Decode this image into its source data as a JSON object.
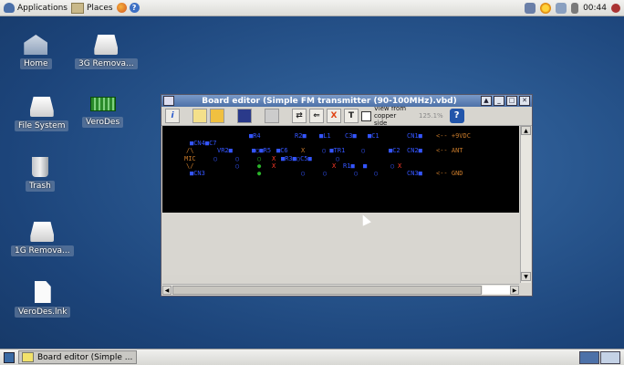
{
  "top_panel": {
    "applications_label": "Applications",
    "places_label": "Places",
    "clock": "00:44"
  },
  "desktop_icons": [
    {
      "label": "Home",
      "icon": "home-folder-icon"
    },
    {
      "label": "3G Remova...",
      "icon": "drive-icon"
    },
    {
      "label": "File System",
      "icon": "drive-icon"
    },
    {
      "label": "VeroDes",
      "icon": "verodes-app-icon"
    },
    {
      "label": "Trash",
      "icon": "trash-icon"
    },
    {
      "label": "1G Remova...",
      "icon": "drive-icon"
    },
    {
      "label": "VeroDes.lnk",
      "icon": "file-icon"
    }
  ],
  "window": {
    "title": "Board editor (Simple FM transmitter (90-100MHz).vbd)",
    "toolbar": {
      "info": "i",
      "text_tool": "T",
      "delete": "X",
      "view_from_copper": "View from copper side",
      "zoom": "125.1%",
      "help": "?"
    },
    "board": {
      "row1": {
        "a": "R4",
        "b": "R2",
        "c": "L1",
        "d": "C3",
        "e": "C1",
        "f": "CN1",
        "g": "<-- +9VDC"
      },
      "row2": {
        "a": "CN4",
        "b": "C7",
        "c": "CN2",
        "d": "<-- ANT"
      },
      "row3": {
        "a": "/\\",
        "b": "VR2",
        "c": "R5",
        "d": "C6",
        "e": "R1",
        "f": "TR1",
        "g": "C2"
      },
      "row4": {
        "a": "MIC",
        "b": "R3",
        "c": "C5"
      },
      "row5": {
        "a": "\\/",
        "b": "R1"
      },
      "row6": {
        "a": "CN3",
        "b": "CN3",
        "c": "<-- GND"
      }
    }
  },
  "taskbar": {
    "task_label": "Board editor (Simple ..."
  },
  "colors": {
    "desktop": "#2a5890",
    "titlebar": "#4d71a8",
    "board_bg": "#000000",
    "pad_blue": "#3455ff",
    "silk_orange": "#c87a2a"
  }
}
